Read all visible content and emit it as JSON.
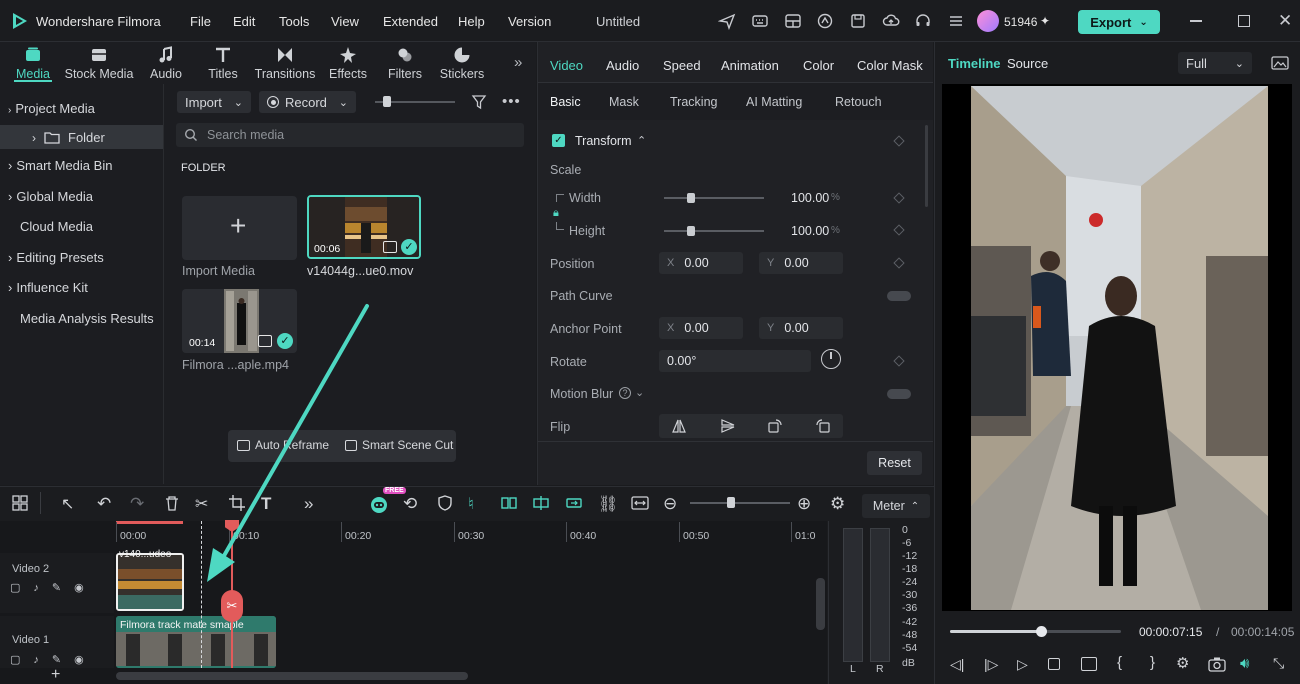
{
  "app": {
    "name": "Wondershare Filmora",
    "project_title": "Untitled",
    "user_count": "51946"
  },
  "menu": [
    "File",
    "Edit",
    "Tools",
    "View",
    "Extended",
    "Help",
    "Version"
  ],
  "export": {
    "label": "Export"
  },
  "media_tools": [
    {
      "label": "Media",
      "icon": "media-icon"
    },
    {
      "label": "Stock Media",
      "icon": "stock-media-icon"
    },
    {
      "label": "Audio",
      "icon": "music-note-icon"
    },
    {
      "label": "Titles",
      "icon": "titles-icon"
    },
    {
      "label": "Transitions",
      "icon": "transitions-icon"
    },
    {
      "label": "Effects",
      "icon": "effects-icon"
    },
    {
      "label": "Filters",
      "icon": "filters-icon"
    },
    {
      "label": "Stickers",
      "icon": "stickers-icon"
    }
  ],
  "sidebar": {
    "items": [
      {
        "label": "Project Media",
        "expandable": true
      },
      {
        "label": "Folder",
        "expandable": true
      },
      {
        "label": "Smart Media Bin",
        "expandable": true
      },
      {
        "label": "Global Media",
        "expandable": true
      },
      {
        "label": "Cloud Media",
        "expandable": false
      },
      {
        "label": "Editing Presets",
        "expandable": true
      },
      {
        "label": "Influence Kit",
        "expandable": true
      },
      {
        "label": "Media Analysis Results",
        "expandable": false
      }
    ]
  },
  "media": {
    "import_label": "Import",
    "record_label": "Record",
    "search_placeholder": "Search media",
    "folder_heading": "FOLDER",
    "import_media_label": "Import Media",
    "items": [
      {
        "name": "v14044g...ue0.mov",
        "duration": "00:06"
      },
      {
        "name": "Filmora ...aple.mp4",
        "duration": "00:14"
      }
    ],
    "auto_reframe": "Auto Reframe",
    "smart_scene_cut": "Smart Scene Cut"
  },
  "props": {
    "tabs": [
      "Video",
      "Audio",
      "Speed",
      "Animation",
      "Color",
      "Color Mask"
    ],
    "subtabs": [
      "Basic",
      "Mask",
      "Tracking",
      "AI Matting",
      "Retouch"
    ],
    "transform": "Transform",
    "scale": "Scale",
    "width_label": "Width",
    "height_label": "Height",
    "width_value": "100.00",
    "height_value": "100.00",
    "percent": "%",
    "scale_width_fraction": 0.27,
    "scale_height_fraction": 0.27,
    "position_label": "Position",
    "position_x": "0.00",
    "position_y": "0.00",
    "path_curve": "Path Curve",
    "anchor_label": "Anchor Point",
    "anchor_x": "0.00",
    "anchor_y": "0.00",
    "rotate_label": "Rotate",
    "rotate_value": "0.00°",
    "motion_blur": "Motion Blur",
    "flip": "Flip",
    "reset": "Reset",
    "axis_x": "X",
    "axis_y": "Y"
  },
  "preview": {
    "tabs": [
      "Timeline",
      "Source"
    ],
    "quality": "Full",
    "current_time": "00:00:07:15",
    "total_time": "00:00:14:05",
    "separator": "/",
    "progress_fraction": 0.53
  },
  "timeline": {
    "ruler": [
      "00:00",
      "00:10",
      "00:20",
      "00:30",
      "00:40",
      "00:50",
      "01:0"
    ],
    "tracks": [
      {
        "label": "Video 2",
        "clip": "v140...udeo"
      },
      {
        "label": "Video 1",
        "clip": "Filmora track mate smaple"
      }
    ],
    "meter": "Meter",
    "meter_scale": [
      "0",
      "-6",
      "-12",
      "-18",
      "-24",
      "-30",
      "-36",
      "-42",
      "-48",
      "-54",
      "dB"
    ],
    "meter_channels": [
      "L",
      "R"
    ],
    "badge": "FREE"
  },
  "colors": {
    "accent": "#4ed8c2",
    "playhead": "#e25b5b"
  }
}
